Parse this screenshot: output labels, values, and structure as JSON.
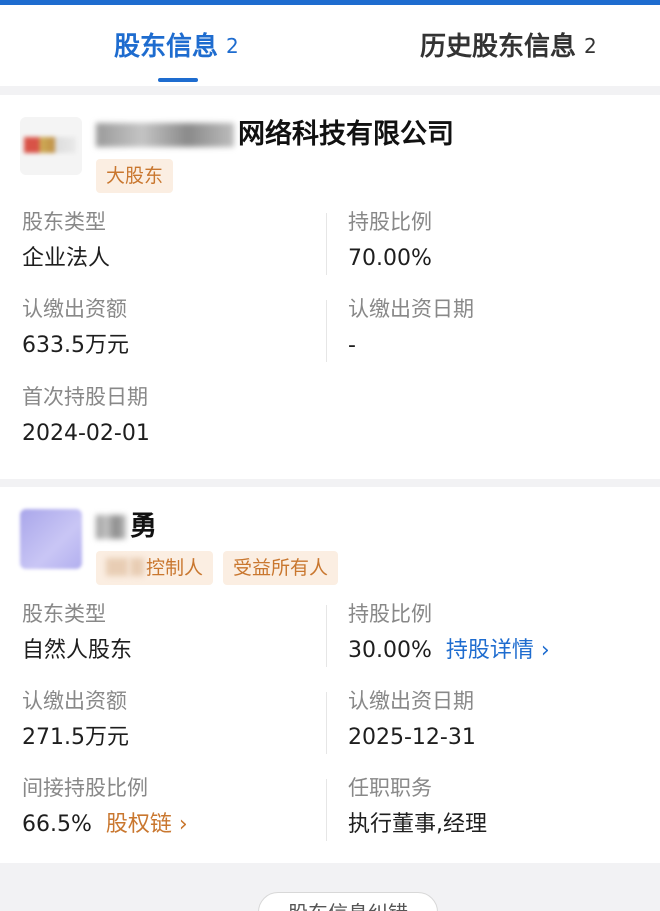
{
  "tabs": [
    {
      "label": "股东信息",
      "count": "2",
      "active": true
    },
    {
      "label": "历史股东信息",
      "count": "2",
      "active": false
    }
  ],
  "shareholders": [
    {
      "name_visible": "网络科技有限公司",
      "tags": [
        "大股东"
      ],
      "type_label": "股东类型",
      "type_value": "企业法人",
      "ratio_label": "持股比例",
      "ratio_value": "70.00%",
      "subscribed_label": "认缴出资额",
      "subscribed_value": "633.5万元",
      "subscribe_date_label": "认缴出资日期",
      "subscribe_date_value": "-",
      "first_date_label": "首次持股日期",
      "first_date_value": "2024-02-01"
    },
    {
      "name_visible": "勇",
      "tag_control_visible": "控制人",
      "tags": [
        "受益所有人"
      ],
      "type_label": "股东类型",
      "type_value": "自然人股东",
      "ratio_label": "持股比例",
      "ratio_value": "30.00%",
      "ratio_link": "持股详情 ›",
      "subscribed_label": "认缴出资额",
      "subscribed_value": "271.5万元",
      "subscribe_date_label": "认缴出资日期",
      "subscribe_date_value": "2025-12-31",
      "indirect_label": "间接持股比例",
      "indirect_value": "66.5%",
      "indirect_link": "股权链 ›",
      "position_label": "任职职务",
      "position_value": "执行董事,经理"
    }
  ],
  "feedback_label": "股东信息纠错",
  "colors": {
    "accent": "#1e6ccf",
    "tag_text": "#c9772f",
    "tag_bg": "#fbeee2"
  }
}
